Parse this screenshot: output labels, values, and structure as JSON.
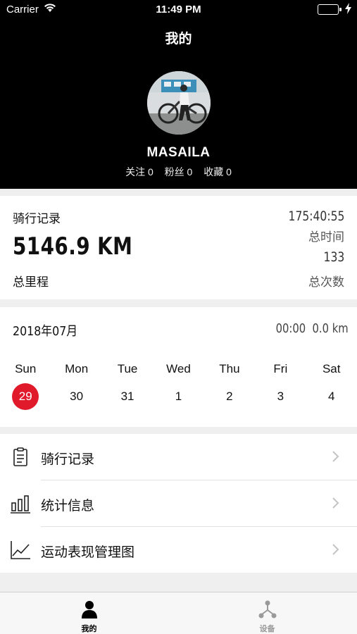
{
  "status_bar": {
    "carrier": "Carrier",
    "time": "11:49 PM",
    "battery_color": "#3fd15a"
  },
  "header": {
    "title": "我的",
    "username": "MASAILA",
    "social": [
      {
        "label": "关注",
        "count": "0"
      },
      {
        "label": "粉丝",
        "count": "0"
      },
      {
        "label": "收藏",
        "count": "0"
      }
    ]
  },
  "record": {
    "title": "骑行记录",
    "distance": "5146.9 KM",
    "distance_label": "总里程",
    "total_time": "175:40:55",
    "total_time_label": "总时间",
    "ride_count": "133",
    "ride_count_label": "总次数"
  },
  "calendar": {
    "month": "2018年07月",
    "summary_time": "00:00",
    "summary_distance": "0.0 km",
    "weekdays": [
      "Sun",
      "Mon",
      "Tue",
      "Wed",
      "Thu",
      "Fri",
      "Sat"
    ],
    "days": [
      "29",
      "30",
      "31",
      "1",
      "2",
      "3",
      "4"
    ],
    "selected_day": "29",
    "accent_color": "#e01a2b"
  },
  "menu": {
    "items": [
      {
        "label": "骑行记录",
        "icon": "clipboard-icon"
      },
      {
        "label": "统计信息",
        "icon": "bar-chart-icon"
      },
      {
        "label": "运动表现管理图",
        "icon": "line-chart-icon"
      }
    ]
  },
  "tab_bar": {
    "tabs": [
      {
        "label": "我的",
        "icon": "person-icon",
        "active": true
      },
      {
        "label": "设备",
        "icon": "device-hub-icon",
        "active": false
      }
    ]
  }
}
